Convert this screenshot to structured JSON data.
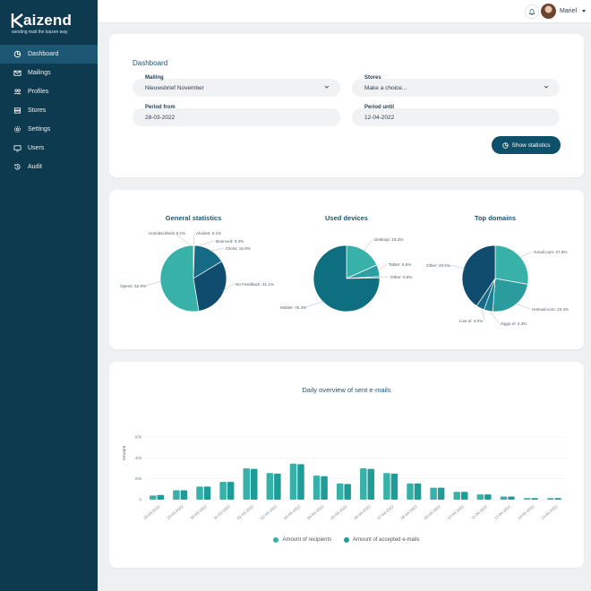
{
  "brand": {
    "name": "aizend",
    "tagline": "sending mail the kaizen way"
  },
  "sidebar": {
    "items": [
      {
        "label": "Dashboard",
        "icon": "dashboard-icon",
        "active": true
      },
      {
        "label": "Mailings",
        "icon": "mailings-icon"
      },
      {
        "label": "Profiles",
        "icon": "profiles-icon"
      },
      {
        "label": "Stores",
        "icon": "stores-icon"
      },
      {
        "label": "Settings",
        "icon": "settings-icon"
      },
      {
        "label": "Users",
        "icon": "users-icon"
      },
      {
        "label": "Audit",
        "icon": "audit-icon"
      }
    ]
  },
  "topbar": {
    "user_name": "Mariel"
  },
  "filters": {
    "title": "Dashboard",
    "mailing": {
      "label": "Mailing",
      "value": "Nieuwsbrief November"
    },
    "stores": {
      "label": "Stores",
      "value": "Make a choice..."
    },
    "period_from": {
      "label": "Period from",
      "value": "28-03-2022"
    },
    "period_until": {
      "label": "Period until",
      "value": "12-04-2022"
    },
    "button_label": "Show statistics"
  },
  "colors": {
    "primary": "#0e3a4f",
    "teal": "#38b2a9",
    "darkteal": "#0e6f80",
    "navy": "#0f4c6e"
  },
  "chart_data": [
    {
      "type": "pie",
      "title": "General statistics",
      "slices": [
        {
          "label": "Unsubscribed: 0.1%",
          "value": 0.1,
          "color": "#9ad8d2"
        },
        {
          "label": "Afvoles: 0.1%",
          "value": 0.1,
          "color": "#6cc7bd"
        },
        {
          "label": "Bounced: 0.3%",
          "value": 0.3,
          "color": "#2a8e9b"
        },
        {
          "label": "Clicks: 15.8%",
          "value": 15.8,
          "color": "#156a86"
        },
        {
          "label": "No Feedback: 31.1%",
          "value": 31.1,
          "color": "#0f4c6e"
        },
        {
          "label": "Opens: 52.6%",
          "value": 52.6,
          "color": "#38b2a9"
        }
      ]
    },
    {
      "type": "pie",
      "title": "Used devices",
      "slices": [
        {
          "label": "Desktop: 18.3%",
          "value": 18.3,
          "color": "#38b2a9"
        },
        {
          "label": "Tablet: 5.8%",
          "value": 5.8,
          "color": "#2b9ea2"
        },
        {
          "label": "Other: 0.6%",
          "value": 0.6,
          "color": "#1d8a95"
        },
        {
          "label": "Mobile: 75.3%",
          "value": 75.3,
          "color": "#0e6f80"
        }
      ]
    },
    {
      "type": "pie",
      "title": "Top domains",
      "slices": [
        {
          "label": "Gmail.com: 27.8%",
          "value": 27.8,
          "color": "#38b2a9"
        },
        {
          "label": "Hotmail.com: 23.4%",
          "value": 23.4,
          "color": "#2a9c9e"
        },
        {
          "label": "Ziggo.nl: 4.3%",
          "value": 4.3,
          "color": "#1c7f92"
        },
        {
          "label": "Live.nl: 4.0%",
          "value": 4.0,
          "color": "#166886"
        },
        {
          "label": "Other: 40.5%",
          "value": 40.5,
          "color": "#0f4c6e"
        }
      ]
    },
    {
      "type": "bar",
      "title": "Daily overview of sent e-mails",
      "ylabel": "Amount",
      "ylim": [
        0,
        80000
      ],
      "yticks": [
        "0",
        "20k",
        "40k",
        "60k"
      ],
      "categories": [
        "28-03-2022",
        "29-03-2022",
        "30-03-2022",
        "31-03-2022",
        "01-04-2022",
        "02-04-2022",
        "03-04-2022",
        "04-04-2022",
        "05-04-2022",
        "06-04-2022",
        "07-04-2022",
        "08-04-2022",
        "09-04-2022",
        "10-04-2022",
        "11-04-2022",
        "12-04-2022",
        "13-04-2022",
        "14-04-2022"
      ],
      "series": [
        {
          "name": "Amount of recipients",
          "color": "#38b2a9",
          "values": [
            4000,
            9000,
            12500,
            17000,
            30000,
            25500,
            34500,
            23000,
            15500,
            30000,
            25500,
            15500,
            11500,
            7500,
            5000,
            3000,
            1500,
            1500
          ]
        },
        {
          "name": "Amount of accepted e-mails",
          "color": "#1f9c98",
          "values": [
            4500,
            9000,
            12500,
            17000,
            29500,
            25000,
            34000,
            22500,
            15000,
            29500,
            25000,
            15500,
            11500,
            7500,
            5000,
            3000,
            1500,
            1500
          ]
        }
      ]
    }
  ]
}
